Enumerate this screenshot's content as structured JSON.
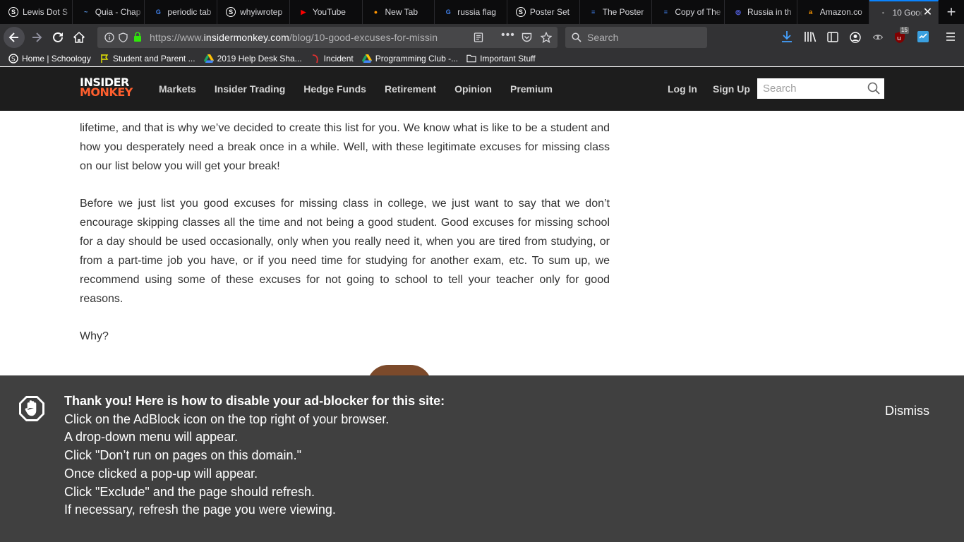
{
  "browser": {
    "tabs": [
      {
        "title": "Lewis Dot S",
        "icon": "schoology-icon",
        "icon_char": "S",
        "icon_color": "#ffffff"
      },
      {
        "title": "Quia - Chap",
        "icon": "quia-icon",
        "icon_char": "~",
        "icon_color": "#5d9cec"
      },
      {
        "title": "periodic tab",
        "icon": "google-icon",
        "icon_char": "G",
        "icon_color": "#4285f4"
      },
      {
        "title": "whyiwrotep",
        "icon": "schoology-icon",
        "icon_char": "S",
        "icon_color": "#ffffff"
      },
      {
        "title": "YouTube",
        "icon": "youtube-icon",
        "icon_char": "▶",
        "icon_color": "#ff0000"
      },
      {
        "title": "New Tab",
        "icon": "firefox-icon",
        "icon_char": "●",
        "icon_color": "#ff9400"
      },
      {
        "title": "russia flag",
        "icon": "google-icon",
        "icon_char": "G",
        "icon_color": "#4285f4"
      },
      {
        "title": "Poster Set",
        "icon": "schoology-icon",
        "icon_char": "S",
        "icon_color": "#ffffff"
      },
      {
        "title": "The Poster",
        "icon": "google-docs-icon",
        "icon_char": "≡",
        "icon_color": "#4285f4"
      },
      {
        "title": "Copy of The",
        "icon": "google-docs-icon",
        "icon_char": "≡",
        "icon_color": "#4285f4"
      },
      {
        "title": "Russia in th",
        "icon": "globe-icon",
        "icon_char": "◎",
        "icon_color": "#5d6cff"
      },
      {
        "title": "Amazon.co",
        "icon": "amazon-icon",
        "icon_char": "a",
        "icon_color": "#ff9900"
      },
      {
        "title": "10 Good",
        "icon": "insidermonkey-icon",
        "icon_char": "•",
        "icon_color": "#888888",
        "active": true
      }
    ],
    "url": {
      "prefix": "https://www.",
      "host": "insidermonkey.com",
      "path": "/blog/10-good-excuses-for-missin"
    },
    "search_placeholder": "Search",
    "badge_count": "15",
    "bookmarks": [
      {
        "label": "Home | Schoology",
        "icon": "schoology-icon"
      },
      {
        "label": "Student and Parent ...",
        "icon": "flag-icon"
      },
      {
        "label": "2019 Help Desk Sha...",
        "icon": "google-drive-icon"
      },
      {
        "label": "Incident",
        "icon": "incident-icon"
      },
      {
        "label": "Programming Club -...",
        "icon": "google-drive-icon"
      },
      {
        "label": "Important Stuff",
        "icon": "folder-icon"
      }
    ]
  },
  "site": {
    "logo_top": "INSIDER",
    "logo_bottom": "MONKEY",
    "nav": [
      "Markets",
      "Insider Trading",
      "Hedge Funds",
      "Retirement",
      "Opinion",
      "Premium"
    ],
    "login": "Log In",
    "signup": "Sign Up",
    "search_placeholder": "Search",
    "accent_color": "#ff5f2e"
  },
  "article": {
    "p1": "lifetime, and that is why we’ve decided to create this list for you. We know what is like to be a student and how you desperately need a break once in a while. Well, with these legitimate excuses for missing class on our list below you will get your break!",
    "p2": "Before we just list you good excuses for missing class in college, we just want to say that we don’t encourage skipping classes all the time and not being a good student. Good excuses for missing school for a day should be used occasionally, only when you really need it, when you are tired from studying, or from a part-time job you have, or if you need time for studying for another exam, etc. To sum up, we recommend using some of these excuses for not going to school to tell your teacher only for good reasons.",
    "p3": "Why?"
  },
  "adblock": {
    "title": "Thank you! Here is how to disable your ad-blocker for this site:",
    "steps": [
      "Click on the AdBlock icon on the top right of your browser.",
      "A drop-down menu will appear.",
      "Click \"Don’t run on pages on this domain.\"",
      "Once clicked a pop-up will appear.",
      "Click \"Exclude\" and the page should refresh.",
      "If necessary, refresh the page you were viewing."
    ],
    "dismiss": "Dismiss"
  }
}
